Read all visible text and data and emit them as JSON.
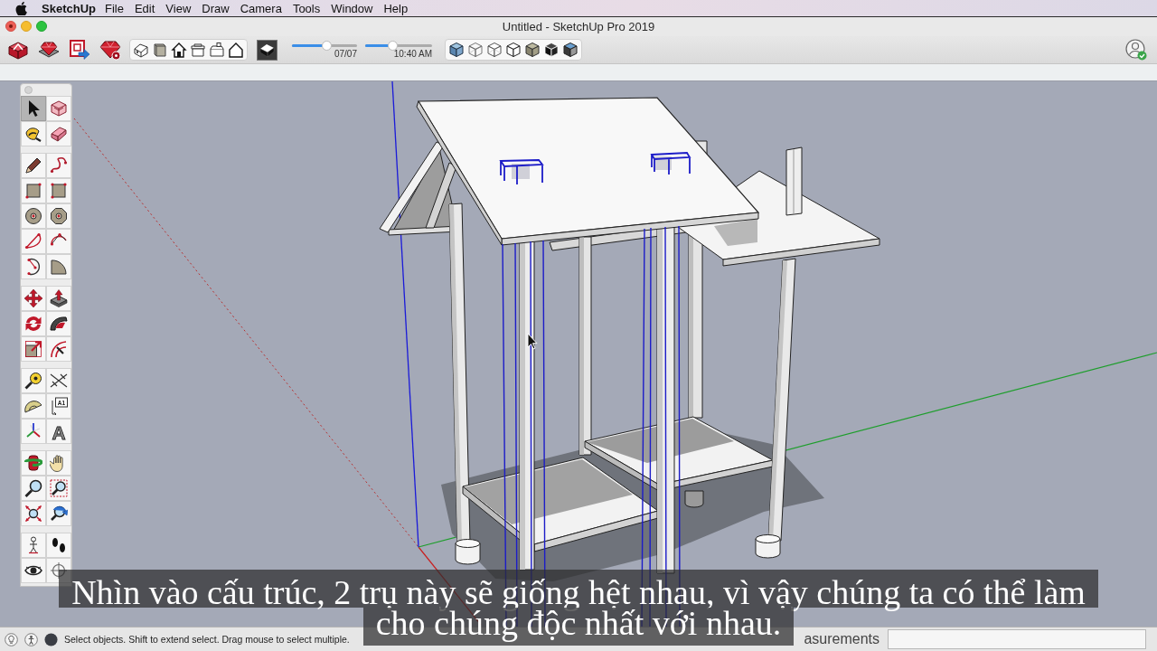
{
  "menu_bar": {
    "app_name": "SketchUp",
    "items": [
      "File",
      "Edit",
      "View",
      "Draw",
      "Camera",
      "Tools",
      "Window",
      "Help"
    ]
  },
  "window": {
    "title": "Untitled - SketchUp Pro 2019"
  },
  "shadow_sliders": [
    {
      "level": 0.54,
      "reading": "07/07"
    },
    {
      "level": 0.41,
      "reading": "10:40 AM"
    }
  ],
  "tool_palette": {
    "groups": [
      [
        {
          "kind": "select",
          "selected": true
        },
        {
          "kind": "component",
          "selected": false
        },
        {
          "kind": "paint",
          "selected": false
        },
        {
          "kind": "eraser",
          "selected": false
        }
      ],
      [
        {
          "kind": "pencil",
          "selected": false
        },
        {
          "kind": "freehand",
          "selected": false
        },
        {
          "kind": "rectangle",
          "selected": false
        },
        {
          "kind": "rotated_rectangle",
          "selected": false
        },
        {
          "kind": "circle",
          "selected": false
        },
        {
          "kind": "polygon",
          "selected": false
        },
        {
          "kind": "arc",
          "selected": false
        },
        {
          "kind": "arc2",
          "selected": false
        },
        {
          "kind": "arc3",
          "selected": false
        },
        {
          "kind": "pie",
          "selected": false
        }
      ],
      [
        {
          "kind": "move",
          "selected": false
        },
        {
          "kind": "pushpull",
          "selected": false
        },
        {
          "kind": "rotate",
          "selected": false
        },
        {
          "kind": "followme",
          "selected": false
        },
        {
          "kind": "scale",
          "selected": false
        },
        {
          "kind": "offset",
          "selected": false
        }
      ],
      [
        {
          "kind": "tape",
          "selected": false
        },
        {
          "kind": "dimension",
          "selected": false
        },
        {
          "kind": "protractor",
          "selected": false
        },
        {
          "kind": "text",
          "selected": false,
          "label": "A1"
        },
        {
          "kind": "axes",
          "selected": false
        },
        {
          "kind": "text3d",
          "selected": false,
          "label": "A"
        }
      ],
      [
        {
          "kind": "orbit",
          "selected": false
        },
        {
          "kind": "pan",
          "selected": false
        },
        {
          "kind": "zoom",
          "selected": false
        },
        {
          "kind": "zoomwindow",
          "selected": false
        },
        {
          "kind": "zoomextents",
          "selected": false
        },
        {
          "kind": "previous",
          "selected": false
        }
      ],
      [
        {
          "kind": "position_camera",
          "selected": false
        },
        {
          "kind": "walk",
          "selected": false
        },
        {
          "kind": "lookaround",
          "selected": false
        },
        {
          "kind": "section",
          "selected": false
        }
      ]
    ]
  },
  "status_bar": {
    "hint": "Select objects. Shift to extend select. Drag mouse to select multiple.",
    "measurements_label": "asurements"
  },
  "subtitle_lines": [
    "Nhìn vào cấu trúc, 2 trụ này sẽ giống hệt nhau, vì vậy chúng ta có thể làm",
    "cho chúng độc nhất với nhau."
  ]
}
